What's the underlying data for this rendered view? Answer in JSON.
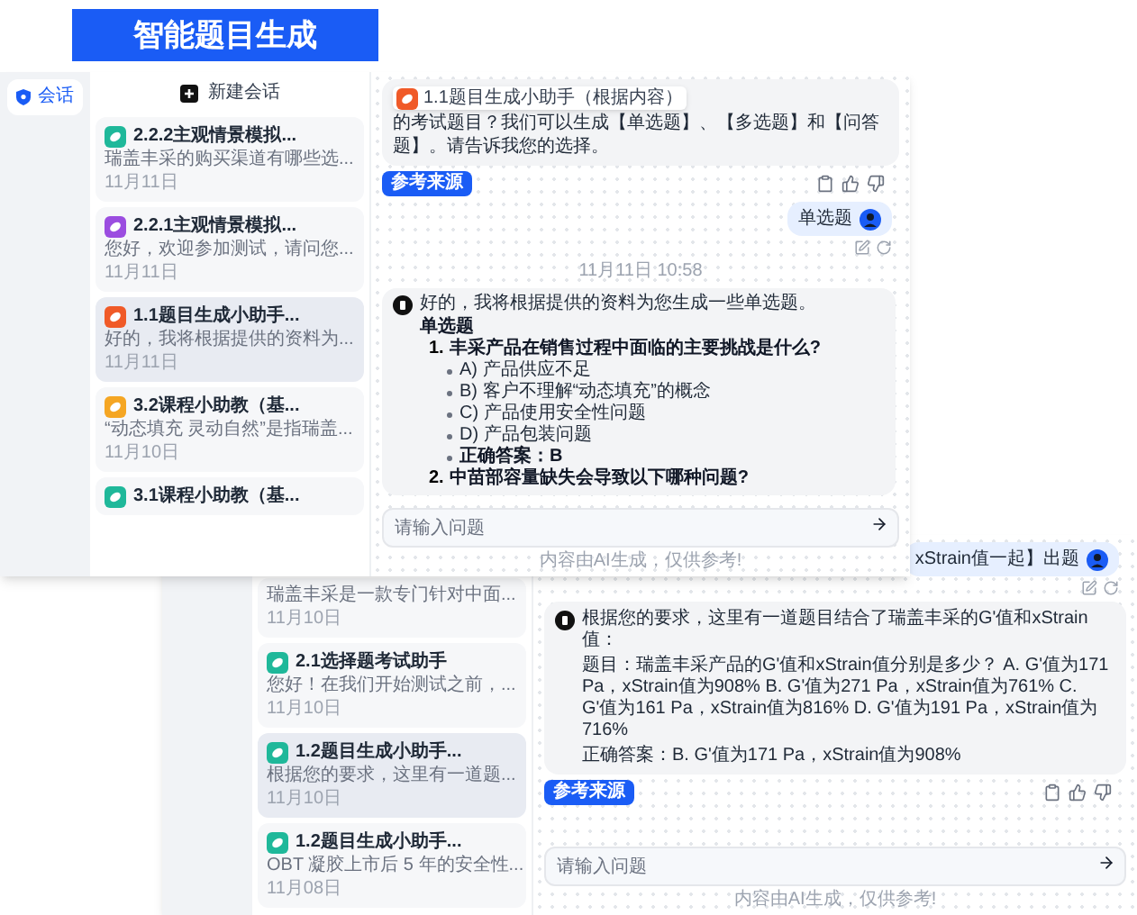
{
  "banner": {
    "title": "智能题目生成"
  },
  "windows": [
    {
      "nav": {
        "label": "会话"
      },
      "new_chat": {
        "label": "新建会话"
      },
      "conversations": [
        {
          "title": "2.2.2主观情景模拟...",
          "preview": "瑞盖丰采的购买渠道有哪些选...",
          "date": "11月11日",
          "color": "#1fb89a",
          "selected": false
        },
        {
          "title": "2.2.1主观情景模拟...",
          "preview": "您好，欢迎参加测试，请问您...",
          "date": "11月11日",
          "color": "#9b4de0",
          "selected": false
        },
        {
          "title": "1.1题目生成小助手...",
          "preview": "好的，我将根据提供的资料为...",
          "date": "11月11日",
          "color": "#f05a28",
          "selected": true
        },
        {
          "title": "3.2课程小助教（基...",
          "preview": "“动态填充 灵动自然”是指瑞盖...",
          "date": "11月10日",
          "color": "#f5a623",
          "selected": false
        },
        {
          "title": "3.1课程小助教（基...",
          "color": "#1fb89a",
          "selected": false
        }
      ],
      "messages": [
        {
          "kind": "bot",
          "tooltip": "1.1题目生成小助手（根据内容）",
          "lines": [
            "的考试题目？我们可以生成【单选题】、【多选题】和【问答题】。请告诉我您的选择。"
          ],
          "source": "参考来源"
        },
        {
          "kind": "user",
          "text": "单选题"
        },
        {
          "kind": "time",
          "text": "11月11日 10:58"
        },
        {
          "kind": "quiz",
          "intro": "好的，我将根据提供的资料为您生成一些单选题。",
          "heading": "单选题",
          "questions": [
            {
              "number": "1.",
              "text": "丰采产品在销售过程中面临的主要挑战是什么?",
              "options": [
                "A) 产品供应不足",
                "B) 客户不理解“动态填充”的概念",
                "C) 产品使用安全性问题",
                "D) 产品包装问题"
              ],
              "answer": "正确答案：B"
            },
            {
              "number": "2.",
              "text": "中苗部容量缺失会导致以下哪种问题?"
            }
          ]
        }
      ],
      "input": {
        "placeholder": "请输入问题"
      },
      "disclaimer": "内容由AI生成，仅供参考!"
    },
    {
      "conversations": [
        {
          "preview": "瑞盖丰采是一款专门针对中面...",
          "date": "11月10日",
          "selected": false
        },
        {
          "title": "2.1选择题考试助手",
          "preview": "您好！在我们开始测试之前，...",
          "date": "11月10日",
          "color": "#1fb89a",
          "selected": false
        },
        {
          "title": "1.2题目生成小助手...",
          "preview": "根据您的要求，这里有一道题...",
          "date": "11月10日",
          "color": "#1fb89a",
          "selected": true
        },
        {
          "title": "1.2题目生成小助手...",
          "preview": "OBT 凝胶上市后 5 年的安全性...",
          "date": "11月08日",
          "color": "#1fb89a",
          "selected": false
        }
      ],
      "messages": [
        {
          "kind": "user",
          "text": "xStrain值一起】出题"
        },
        {
          "kind": "bot",
          "lines": [
            "根据您的要求，这里有一道题目结合了瑞盖丰采的G'值和xStrain值：",
            "题目：瑞盖丰采产品的G'值和xStrain值分别是多少？ A. G'值为171 Pa，xStrain值为908% B. G'值为271 Pa，xStrain值为761% C. G'值为161 Pa，xStrain值为816% D. G'值为191 Pa，xStrain值为716%",
            "正确答案：B. G'值为171 Pa，xStrain值为908%"
          ],
          "source": "参考来源"
        }
      ],
      "input": {
        "placeholder": "请输入问题"
      },
      "disclaimer": "内容由AI生成，仅供参考!"
    }
  ]
}
